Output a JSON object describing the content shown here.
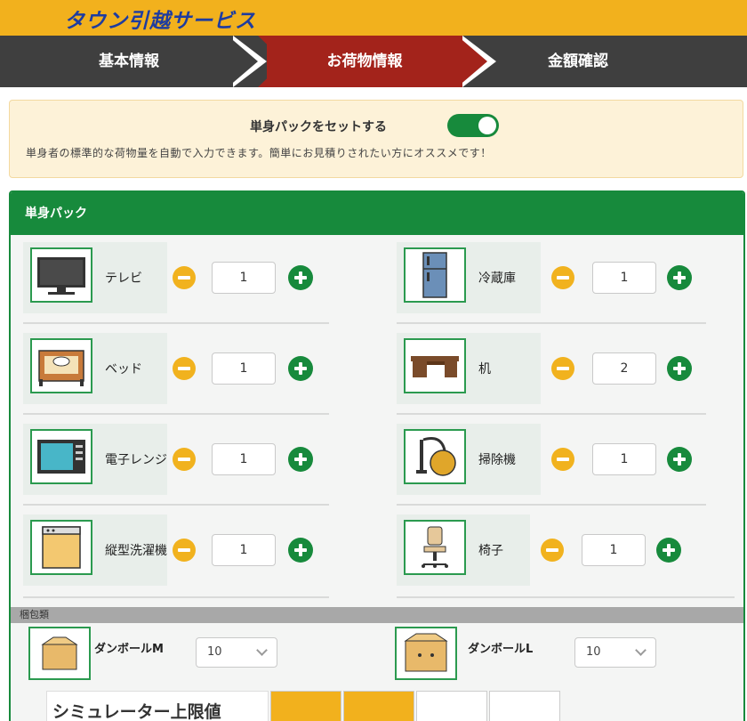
{
  "header": {
    "logo": "タウン引越サービス"
  },
  "steps": [
    {
      "label": "基本情報",
      "active": false
    },
    {
      "label": "お荷物情報",
      "active": true
    },
    {
      "label": "金額確認",
      "active": false
    }
  ],
  "pack_toggle": {
    "label": "単身パックをセットする",
    "on": true,
    "description": "単身者の標準的な荷物量を自動で入力できます。簡単にお見積りされたい方にオススメです！"
  },
  "panel": {
    "title": "単身パック",
    "items": [
      {
        "label": "テレビ",
        "qty": "1",
        "icon": "tv-icon"
      },
      {
        "label": "冷蔵庫",
        "qty": "1",
        "icon": "refrigerator-icon"
      },
      {
        "label": "ベッド",
        "qty": "1",
        "icon": "bed-icon"
      },
      {
        "label": "机",
        "qty": "2",
        "icon": "desk-icon"
      },
      {
        "label": "電子レンジ",
        "qty": "1",
        "icon": "microwave-icon"
      },
      {
        "label": "掃除機",
        "qty": "1",
        "icon": "vacuum-icon"
      },
      {
        "label": "縦型洗濯機",
        "qty": "1",
        "icon": "washing-machine-icon"
      },
      {
        "label": "椅子",
        "qty": "1",
        "icon": "chair-icon"
      }
    ],
    "packing_section": "梱包類",
    "boxes": [
      {
        "label": "ダンボールM",
        "value": "10",
        "icon": "cardboard-box-m-icon"
      },
      {
        "label": "ダンボールL",
        "value": "10",
        "icon": "cardboard-box-l-icon"
      }
    ],
    "simulator_label": "シミュレーター上限値"
  },
  "colors": {
    "brand_yellow": "#f2b11d",
    "step_active": "#a3231b",
    "step_dark": "#3f3f3f",
    "green": "#178a3c",
    "logo_blue": "#1e3ca0"
  }
}
